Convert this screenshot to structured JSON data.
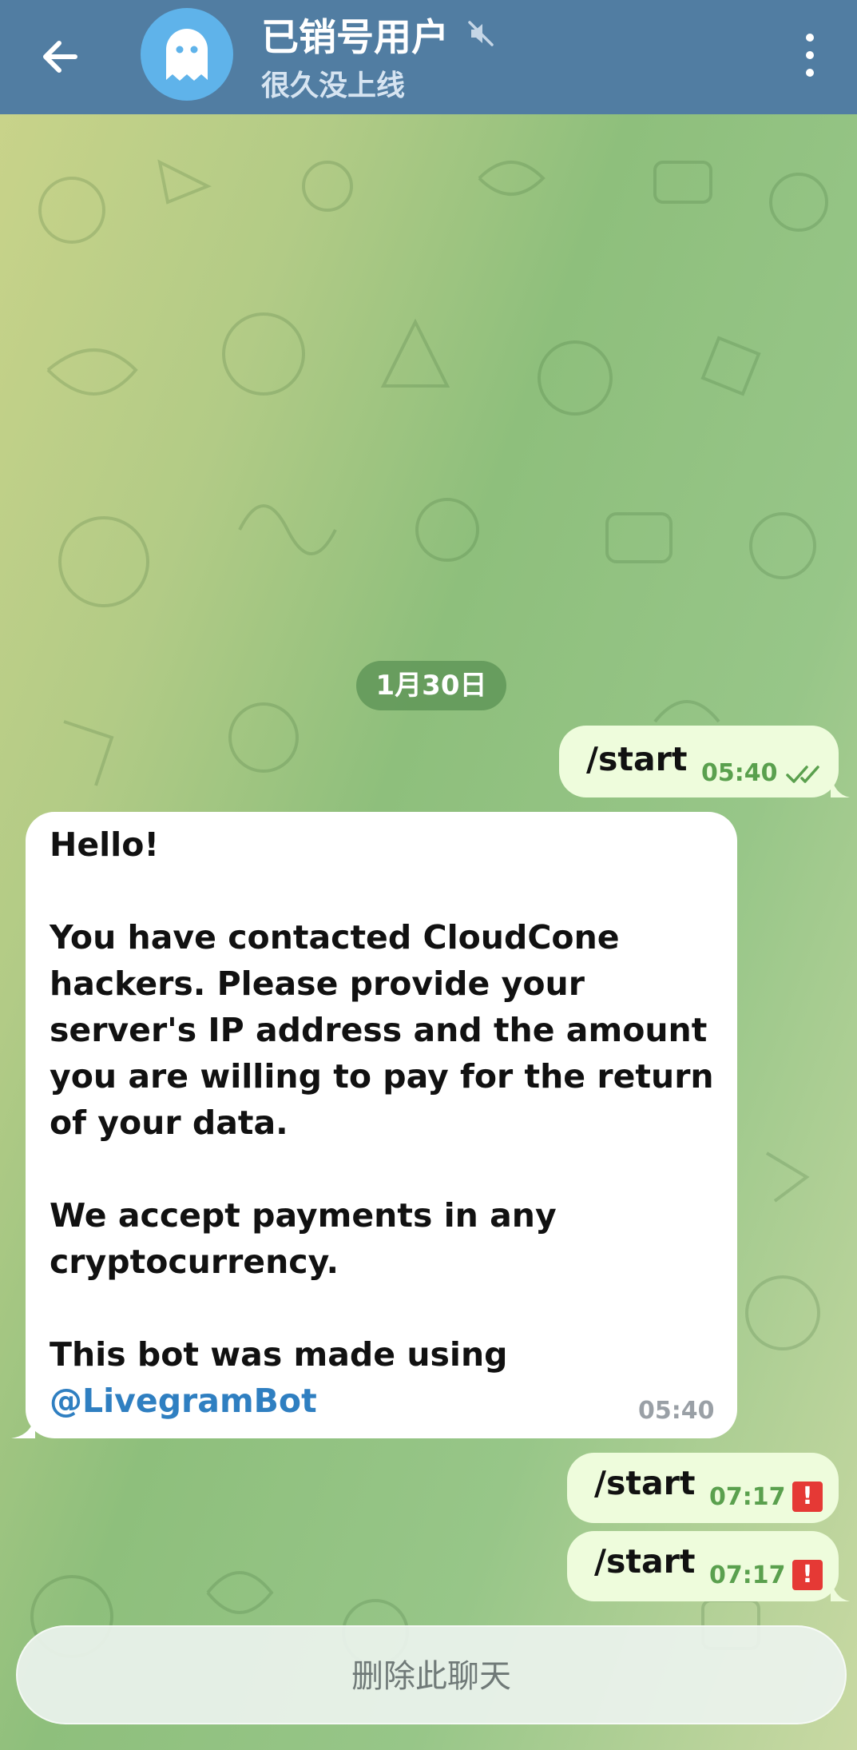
{
  "header": {
    "back_icon": "arrow-left-icon",
    "avatar_icon": "ghost-icon",
    "title": "已销号用户",
    "mute_icon": "muted-speaker-icon",
    "subtitle": "很久没上线",
    "menu_icon": "more-vertical-icon",
    "bar_color": "#517da2",
    "avatar_color": "#5fb3ea"
  },
  "chat": {
    "date_label": "1月30日",
    "messages": [
      {
        "direction": "out",
        "text": "/start",
        "time": "05:40",
        "status_icon": "double-check-icon"
      },
      {
        "direction": "in",
        "paragraphs": [
          "Hello!",
          "You have contacted CloudCone hackers. Please provide your server's IP address and the amount you are willing to pay for the return of your data.",
          "We accept payments in any cryptocurrency.",
          "This bot was made using"
        ],
        "link": "@LivegramBot",
        "time": "05:40"
      },
      {
        "direction": "out",
        "text": "/start",
        "time": "07:17",
        "status_icon": "error-icon",
        "status_symbol": "!"
      },
      {
        "direction": "out",
        "text": "/start",
        "time": "07:17",
        "status_icon": "error-icon",
        "status_symbol": "!"
      }
    ]
  },
  "footer": {
    "delete_label": "删除此聊天"
  },
  "colors": {
    "outgoing_bubble": "#eefcdc",
    "incoming_bubble": "#ffffff",
    "time_green": "#5aa04e",
    "link_blue": "#2f7fc1",
    "error_red": "#e53935"
  }
}
